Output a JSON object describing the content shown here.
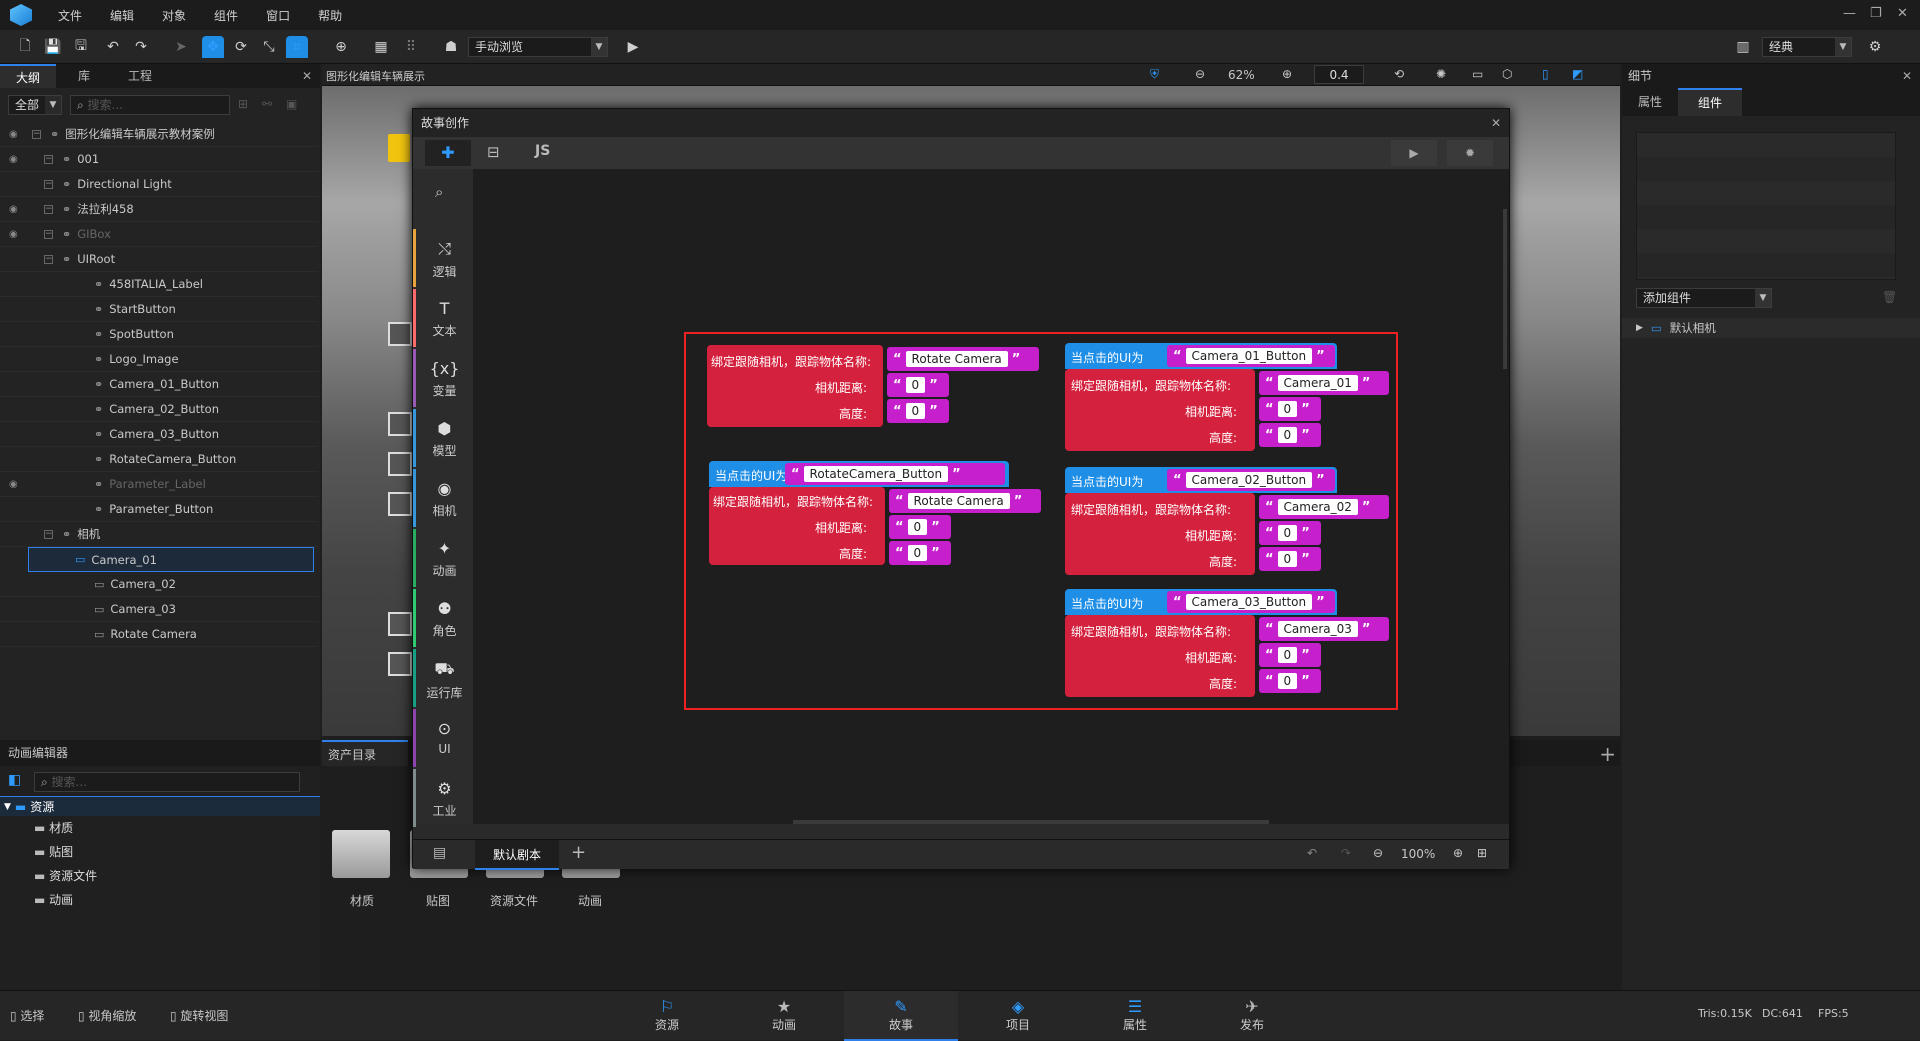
{
  "menu": [
    "文件",
    "编辑",
    "对象",
    "组件",
    "窗口",
    "帮助"
  ],
  "toolbar": {
    "mode_select": "手动浏览",
    "layout_select": "经典"
  },
  "outline": {
    "tabs": [
      "大纲",
      "库",
      "工程"
    ],
    "filter": "全部",
    "search_placeholder": "搜索...",
    "rows": [
      {
        "label": "图形化编辑车辆展示教材案例",
        "depth": 0,
        "eye": true,
        "dim": false
      },
      {
        "label": "001",
        "depth": 1,
        "eye": true,
        "dim": false
      },
      {
        "label": "Directional Light",
        "depth": 1,
        "eye": false,
        "dim": false
      },
      {
        "label": "法拉利458",
        "depth": 1,
        "eye": true,
        "dim": false
      },
      {
        "label": "GIBox",
        "depth": 1,
        "eye": true,
        "dim": true
      },
      {
        "label": "UIRoot",
        "depth": 1,
        "eye": false,
        "dim": false
      },
      {
        "label": "458ITALIA_Label",
        "depth": 2,
        "eye": false,
        "dim": false
      },
      {
        "label": "StartButton",
        "depth": 2,
        "eye": false,
        "dim": false
      },
      {
        "label": "SpotButton",
        "depth": 2,
        "eye": false,
        "dim": false
      },
      {
        "label": "Logo_Image",
        "depth": 2,
        "eye": false,
        "dim": false
      },
      {
        "label": "Camera_01_Button",
        "depth": 2,
        "eye": false,
        "dim": false
      },
      {
        "label": "Camera_02_Button",
        "depth": 2,
        "eye": false,
        "dim": false
      },
      {
        "label": "Camera_03_Button",
        "depth": 2,
        "eye": false,
        "dim": false
      },
      {
        "label": "RotateCamera_Button",
        "depth": 2,
        "eye": false,
        "dim": false
      },
      {
        "label": "Parameter_Label",
        "depth": 2,
        "eye": true,
        "dim": true
      },
      {
        "label": "Parameter_Button",
        "depth": 2,
        "eye": false,
        "dim": false
      },
      {
        "label": "相机",
        "depth": 1,
        "eye": false,
        "dim": false
      },
      {
        "label": "Camera_01",
        "depth": 2,
        "eye": false,
        "dim": false,
        "selected": true
      },
      {
        "label": "Camera_02",
        "depth": 2,
        "eye": false,
        "dim": false
      },
      {
        "label": "Camera_03",
        "depth": 2,
        "eye": false,
        "dim": false
      },
      {
        "label": "Rotate Camera",
        "depth": 2,
        "eye": false,
        "dim": false
      }
    ]
  },
  "viewport": {
    "title": "图形化编辑车辆展示",
    "zoom": "62%",
    "value": "0.4"
  },
  "detail": {
    "title": "细节",
    "tabs": [
      "属性",
      "组件"
    ],
    "add_component": "添加组件",
    "tree_item": "默认相机"
  },
  "story": {
    "title": "故事创作",
    "tab_js": "JS",
    "categories": [
      "逻辑",
      "文本",
      "变量",
      "模型",
      "相机",
      "动画",
      "角色",
      "运行库",
      "UI",
      "工业"
    ],
    "script_tab": "默认剧本",
    "zoom": "100%",
    "blocks": {
      "bind_label": "绑定跟随相机，跟踪物体名称:",
      "distance_label": "相机距离:",
      "height_label": "高度:",
      "click_label": "当点击的UI为",
      "rotate_camera": "Rotate Camera",
      "rotate_button": "RotateCamera_Button",
      "cam1_button": "Camera_01_Button",
      "cam2_button": "Camera_02_Button",
      "cam3_button": "Camera_03_Button",
      "cam1": "Camera_01",
      "cam2": "Camera_02",
      "cam3": "Camera_03",
      "zero": "0"
    }
  },
  "anim_editor": {
    "title": "动画编辑器",
    "search_placeholder": "搜索..."
  },
  "assets": {
    "tab": "资产目录",
    "tree": [
      "资源",
      "材质",
      "贴图",
      "资源文件",
      "动画"
    ],
    "folders": [
      "材质",
      "贴图",
      "资源文件",
      "动画"
    ]
  },
  "statusbar": {
    "left": [
      "选择",
      "视角缩放",
      "旋转视图"
    ],
    "tabs": [
      "资源",
      "动画",
      "故事",
      "项目",
      "属性",
      "发布"
    ],
    "active_tab": "故事",
    "stats": [
      "Tris:0.15K",
      "DC:641",
      "FPS:5"
    ]
  }
}
